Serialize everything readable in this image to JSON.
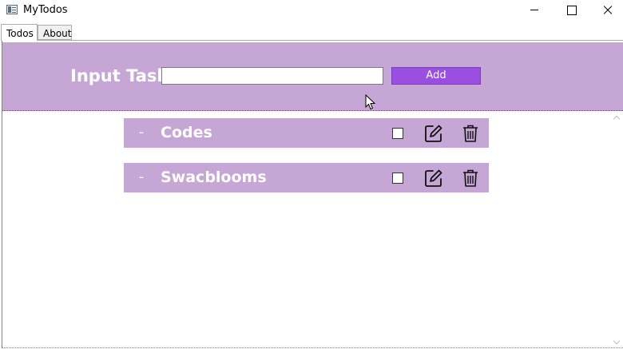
{
  "window": {
    "title": "MyTodos",
    "controls": [
      "minimize-icon",
      "maximize-icon",
      "close-icon"
    ]
  },
  "tabs": [
    {
      "label": "Todos",
      "selected": true
    },
    {
      "label": "About",
      "selected": false
    }
  ],
  "header": {
    "input_label": "Input Task",
    "input_value": "",
    "input_placeholder": "",
    "add_label": "Add"
  },
  "todos": [
    {
      "bullet": "-",
      "title": "Codes",
      "done": false,
      "icons": [
        "edit-icon",
        "trash-icon"
      ]
    },
    {
      "bullet": "-",
      "title": "Swacblooms",
      "done": false,
      "icons": [
        "edit-icon",
        "trash-icon"
      ]
    }
  ],
  "colors": {
    "accent": "#c5a6d4",
    "add_button": "#9a4fe0",
    "text_on_accent": "#ffffff"
  }
}
